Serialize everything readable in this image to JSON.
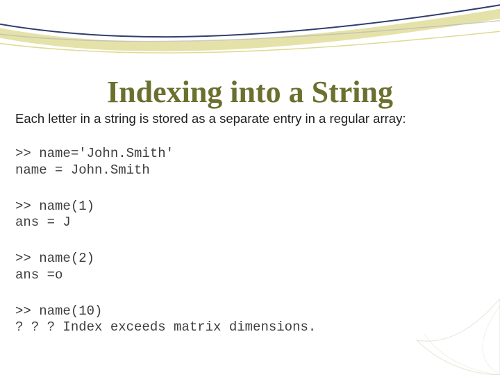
{
  "title": "Indexing into a String",
  "intro": "Each letter in a string is stored as a separate entry in a regular array:",
  "blocks": [
    ">> name='John.Smith'\nname = John.Smith",
    ">> name(1)\nans = J",
    ">> name(2)\nans =o",
    ">> name(10)\n? ? ? Index exceeds matrix dimensions."
  ]
}
